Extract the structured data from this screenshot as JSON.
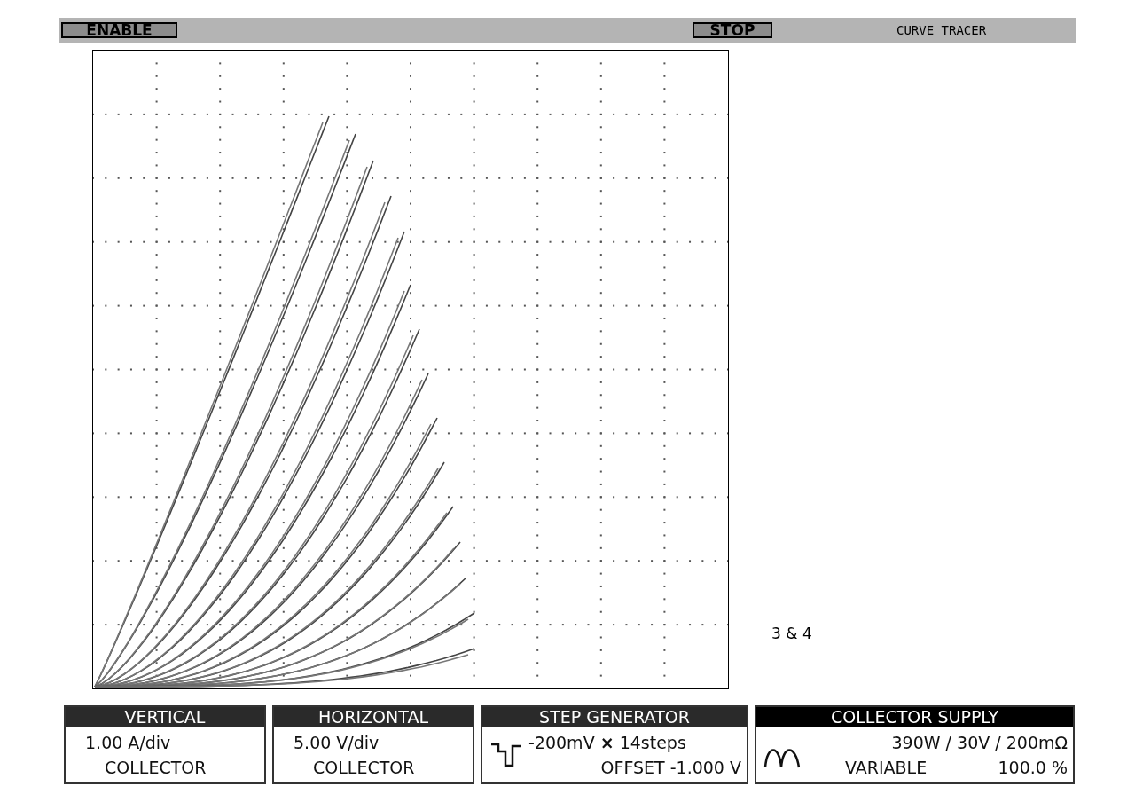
{
  "top_bar": {
    "buttons": [
      {
        "label": "ENABLE"
      },
      {
        "label": "STOP"
      }
    ],
    "title": "CURVE TRACER"
  },
  "graticule": {
    "annotation": "3 & 4"
  },
  "panels": [
    {
      "kind": "text",
      "title": "VERTICAL",
      "lines": [
        [
          "1.00 A/div"
        ],
        [
          "COLLECTOR"
        ]
      ]
    },
    {
      "kind": "text",
      "title": "HORIZONTAL",
      "lines": [
        [
          "5.00 V/div"
        ],
        [
          "COLLECTOR"
        ]
      ]
    },
    {
      "kind": "step",
      "title": "STEP GENERATOR",
      "lines": [
        [
          "-200mV **×** 14steps"
        ],
        [
          "OFFSET -1.000 V"
        ]
      ]
    },
    {
      "kind": "supply",
      "title": "COLLECTOR SUPPLY",
      "lines": [
        [
          "390W / 30V / 200mΩ"
        ],
        [
          "VARIABLE",
          "100.0 %"
        ]
      ]
    }
  ]
}
